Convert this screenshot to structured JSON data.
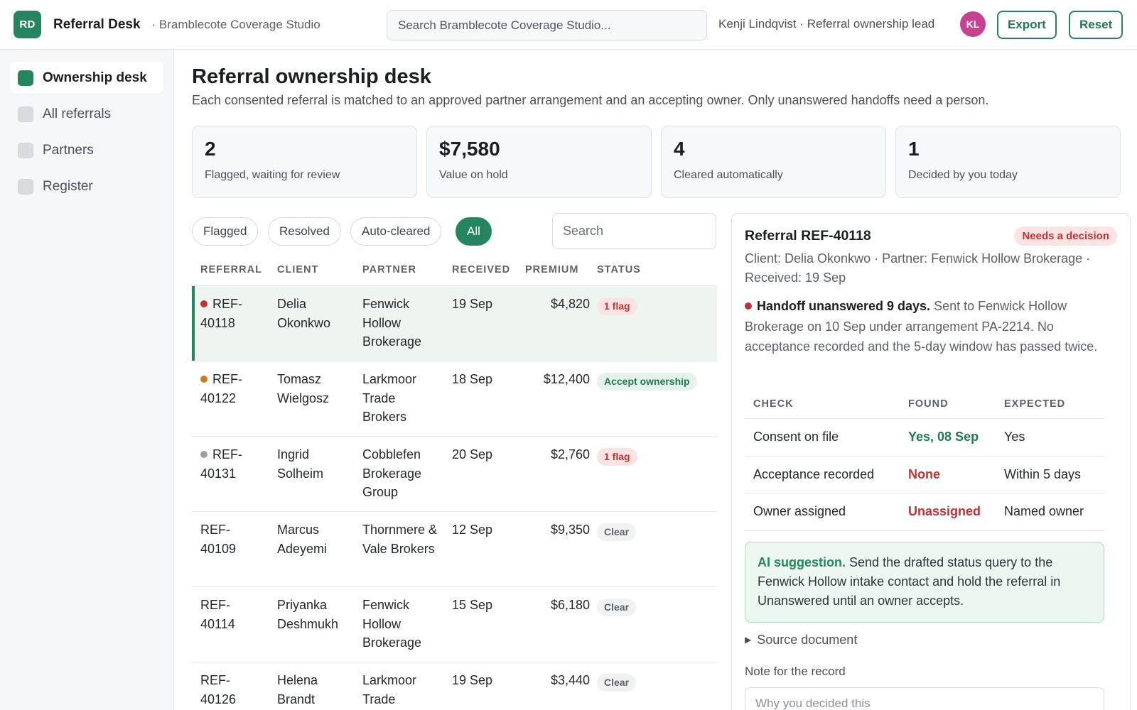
{
  "header": {
    "logo": "RD",
    "app_name": "Referral Desk",
    "org": "· Bramblecote Coverage Studio",
    "search_placeholder": "Search Bramblecote Coverage Studio...",
    "user_label": "Kenji Lindqvist · Referral ownership lead",
    "avatar_initials": "KL",
    "export_label": "Export",
    "reset_label": "Reset"
  },
  "sidebar": {
    "items": [
      {
        "label": "Ownership desk",
        "active": true
      },
      {
        "label": "All referrals",
        "active": false
      },
      {
        "label": "Partners",
        "active": false
      },
      {
        "label": "Register",
        "active": false
      }
    ]
  },
  "page": {
    "title": "Referral ownership desk",
    "description": "Each consented referral is matched to an approved partner arrangement and an accepting owner. Only unanswered handoffs need a person."
  },
  "stats": [
    {
      "value": "2",
      "label": "Flagged, waiting for review"
    },
    {
      "value": "$7,580",
      "label": "Value on hold"
    },
    {
      "value": "4",
      "label": "Cleared automatically"
    },
    {
      "value": "1",
      "label": "Decided by you today"
    }
  ],
  "filters": {
    "chips": [
      "Flagged",
      "Resolved",
      "Auto-cleared",
      "All"
    ],
    "active": "All",
    "search_placeholder": "Search"
  },
  "table": {
    "columns": [
      "REFERRAL",
      "CLIENT",
      "PARTNER",
      "RECEIVED",
      "PREMIUM",
      "STATUS"
    ],
    "rows": [
      {
        "ref": "REF-\n40118",
        "client": "Delia Okonkwo",
        "partner": "Fenwick Hollow Brokerage",
        "received": "19 Sep",
        "premium": "$4,820",
        "status": "1 flag",
        "status_type": "flag",
        "dot": "#c23232",
        "selected": true
      },
      {
        "ref": "REF-\n40122",
        "client": "Tomasz Wielgosz",
        "partner": "Larkmoor Trade Brokers",
        "received": "18 Sep",
        "premium": "$12,400",
        "status": "Accept ownership",
        "status_type": "accept",
        "dot": "#c97a1e",
        "selected": false
      },
      {
        "ref": "REF-\n40131",
        "client": "Ingrid Solheim",
        "partner": "Cobblefen Brokerage Group",
        "received": "20 Sep",
        "premium": "$2,760",
        "status": "1 flag",
        "status_type": "flag",
        "dot": "#9aa0a6",
        "selected": false
      },
      {
        "ref": "REF-\n40109",
        "client": "Marcus Adeyemi",
        "partner": "Thornmere & Vale Brokers",
        "received": "12 Sep",
        "premium": "$9,350",
        "status": "Clear",
        "status_type": "clear",
        "dot": "",
        "selected": false
      },
      {
        "ref": "REF-\n40114",
        "client": "Priyanka Deshmukh",
        "partner": "Fenwick Hollow Brokerage",
        "received": "15 Sep",
        "premium": "$6,180",
        "status": "Clear",
        "status_type": "clear",
        "dot": "",
        "selected": false
      },
      {
        "ref": "REF-\n40126",
        "client": "Helena Brandt",
        "partner": "Larkmoor Trade Brokers",
        "received": "19 Sep",
        "premium": "$3,440",
        "status": "Clear",
        "status_type": "clear",
        "dot": "",
        "selected": false
      }
    ]
  },
  "detail": {
    "title": "Referral REF-40118",
    "badge": "Needs a decision",
    "meta": "Client: Delia Okonkwo · Partner: Fenwick Hollow Brokerage · Received: 19 Sep",
    "issue_title": "Handoff unanswered 9 days.",
    "issue_text": "Sent to Fenwick Hollow Brokerage on 10 Sep under arrangement PA-2214. No acceptance recorded and the 5-day window has passed twice.",
    "issue_dot": "#c23232",
    "check_columns": [
      "CHECK",
      "FOUND",
      "EXPECTED"
    ],
    "checks": [
      {
        "check": "Consent on file",
        "found": "Yes, 08 Sep",
        "expected": "Yes",
        "ok": true
      },
      {
        "check": "Acceptance recorded",
        "found": "None",
        "expected": "Within 5 days",
        "ok": false
      },
      {
        "check": "Owner assigned",
        "found": "Unassigned",
        "expected": "Named owner",
        "ok": false
      }
    ],
    "ai_label": "AI suggestion.",
    "ai_text": "Send the drafted status query to the Fenwick Hollow intake contact and hold the referral in Unanswered until an owner accepts.",
    "source_label": "Source document",
    "note_label": "Note for the record",
    "note_placeholder": "Why you decided this"
  },
  "colors": {
    "accent": "#25855f",
    "danger": "#c23232",
    "warning": "#c97a1e",
    "avatar": "#c8418f"
  }
}
